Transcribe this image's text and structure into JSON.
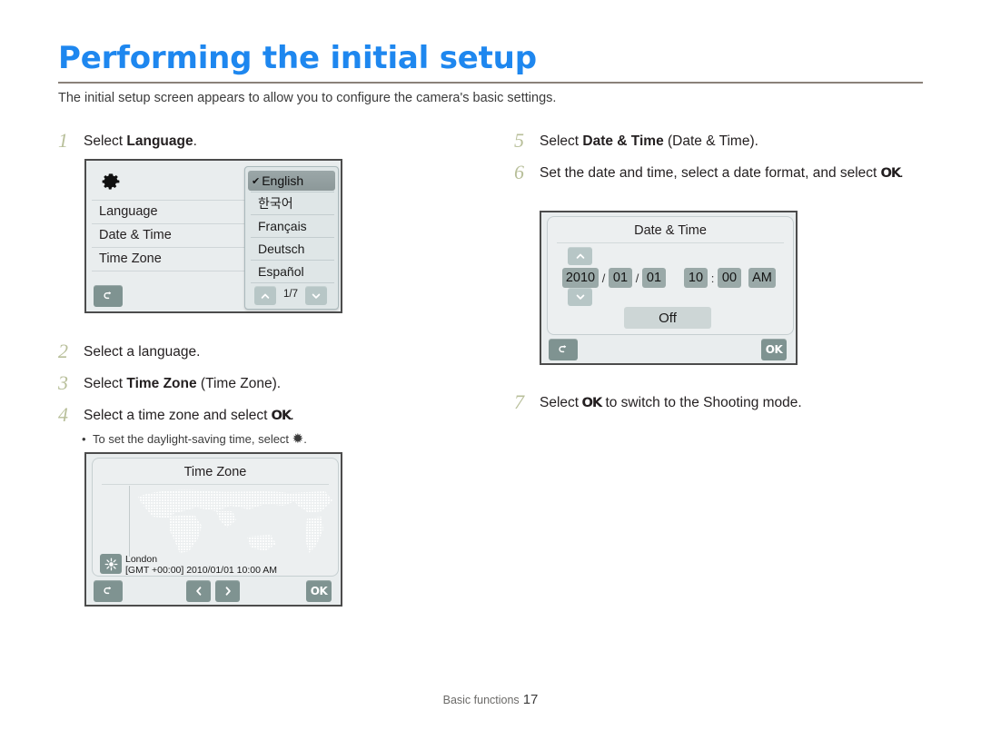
{
  "document": {
    "title": "Performing the initial setup",
    "intro": "The initial setup screen appears to allow you to configure the camera's basic settings.",
    "accent_color": "#1e87ef",
    "rule_color": "#8a8179",
    "step_number_color": "#b8bf9a"
  },
  "steps": {
    "s1": {
      "num": "1",
      "pre": "Select ",
      "bold": "Language",
      "post": "."
    },
    "s2": {
      "num": "2",
      "pre": "Select a language.",
      "bold": "",
      "post": ""
    },
    "s3": {
      "num": "3",
      "pre": "Select ",
      "bold": "Time Zone",
      "post": " (Time Zone)."
    },
    "s4": {
      "num": "4",
      "pre": "Select a time zone and select ",
      "ok": "OK",
      "post": ".",
      "bullet_pre": "To set the daylight-saving time, select ",
      "bullet_icon": "✹",
      "bullet_post": "."
    },
    "s5": {
      "num": "5",
      "pre": "Select ",
      "bold": "Date & Time",
      "post": " (Date & Time)."
    },
    "s6": {
      "num": "6",
      "pre": "Set the date and time, select a date format, and select ",
      "ok": "OK",
      "post": "."
    },
    "s7": {
      "num": "7",
      "pre": "Select ",
      "ok": "OK",
      "post": " to switch to the Shooting mode."
    }
  },
  "language_screen": {
    "gear_icon": "gear-icon",
    "menu_items": [
      "Language",
      "Date & Time",
      "Time Zone"
    ],
    "back_icon": "↰",
    "languages": [
      {
        "label": "English",
        "selected": true,
        "check": "✔"
      },
      {
        "label": "한국어",
        "selected": false,
        "check": ""
      },
      {
        "label": "Français",
        "selected": false,
        "check": ""
      },
      {
        "label": "Deutsch",
        "selected": false,
        "check": ""
      },
      {
        "label": "Español",
        "selected": false,
        "check": ""
      }
    ],
    "page_indicator": "1/7",
    "up_icon": "⌃",
    "down_icon": "⌄"
  },
  "timezone_screen": {
    "title": "Time Zone",
    "city": "London",
    "gmt_line": "[GMT +00:00] 2010/01/01 10:00 AM",
    "sun_icon": "✹",
    "back_icon": "↰",
    "prev_icon": "‹",
    "next_icon": "›",
    "ok_label": "OK"
  },
  "datetime_screen": {
    "title": "Date & Time",
    "year": "2010",
    "month": "01",
    "day": "01",
    "hour": "10",
    "minute": "00",
    "meridiem": "AM",
    "date_sep": "/",
    "time_sep": ":",
    "format_value": "Off",
    "up_icon": "⌃",
    "down_icon": "⌄",
    "back_icon": "↰",
    "ok_label": "OK"
  },
  "footer": {
    "section": "Basic functions",
    "page": "17"
  }
}
